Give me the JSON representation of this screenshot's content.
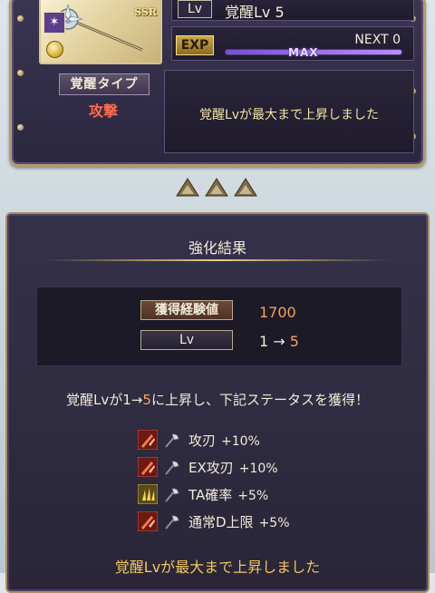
{
  "weapon_card": {
    "rarity": "SSR",
    "element_icon": "dark-element-icon",
    "coin_icon": "gold-coin-icon"
  },
  "awakening_type": {
    "label": "覚醒タイプ",
    "value": "攻撃"
  },
  "level": {
    "tag": "Lv",
    "text": "覚醒Lv 5"
  },
  "exp": {
    "tag": "EXP",
    "next_label": "NEXT 0",
    "bar_label": "MAX",
    "progress": 1.0
  },
  "message_box": {
    "text": "覚醒Lvが最大まで上昇しました"
  },
  "result": {
    "title": "強化結果",
    "exp_gained_label": "獲得経験値",
    "exp_gained_value": "1700",
    "lv_label": "Lv",
    "lv_from": "1 → ",
    "lv_to": "5",
    "summary_prefix": "覚醒Lvが1→",
    "summary_hi": "5",
    "summary_suffix": "に上昇し、下記ステータスを獲得！",
    "bonuses": [
      {
        "name": "攻刃",
        "value": "+10%",
        "icon": "sword-boost-icon"
      },
      {
        "name": "EX攻刃",
        "value": "+10%",
        "icon": "sword-boost-icon"
      },
      {
        "name": "TA確率",
        "value": "+5%",
        "icon": "triple-attack-icon"
      },
      {
        "name": "通常D上限",
        "value": "+5%",
        "icon": "sword-boost-icon"
      }
    ],
    "footer": "覚醒Lvが最大まで上昇しました"
  },
  "colors": {
    "accent_orange": "#f3a25a",
    "attack_red": "#ff6a4a",
    "message_gold": "#f1e3a4",
    "max_purple": "#7b4dd8"
  }
}
